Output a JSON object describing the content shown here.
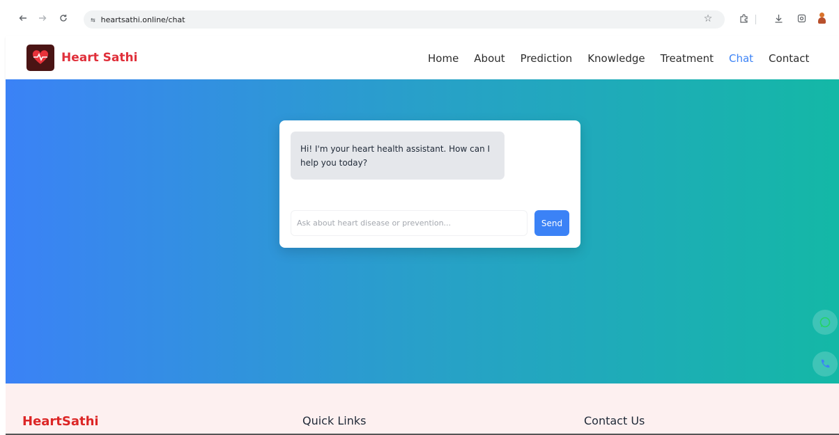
{
  "browser": {
    "url": "heartsathi.online/chat",
    "icons": [
      "back-icon",
      "forward-icon",
      "reload-icon",
      "site-info-icon",
      "star-icon",
      "extensions-icon",
      "downloads-icon",
      "screenshot-icon",
      "profile-icon"
    ]
  },
  "header": {
    "brand": "Heart Sathi",
    "nav": [
      {
        "label": "Home"
      },
      {
        "label": "About"
      },
      {
        "label": "Prediction"
      },
      {
        "label": "Knowledge"
      },
      {
        "label": "Treatment"
      },
      {
        "label": "Chat",
        "active": true
      },
      {
        "label": "Contact"
      }
    ]
  },
  "chat": {
    "bot_message": "Hi! I'm your heart health assistant. How can I help you today?",
    "input_placeholder": "Ask about heart disease or prevention...",
    "input_value": "",
    "send_label": "Send"
  },
  "footer": {
    "brand": "HeartSathi",
    "quick_links_heading": "Quick Links",
    "contact_heading": "Contact Us"
  },
  "colors": {
    "brand_red": "#e02f3a",
    "accent_blue": "#3b82f6",
    "gradient_start": "#3b82f6",
    "gradient_end": "#14b8a6",
    "footer_bg": "#fdf0f0"
  }
}
